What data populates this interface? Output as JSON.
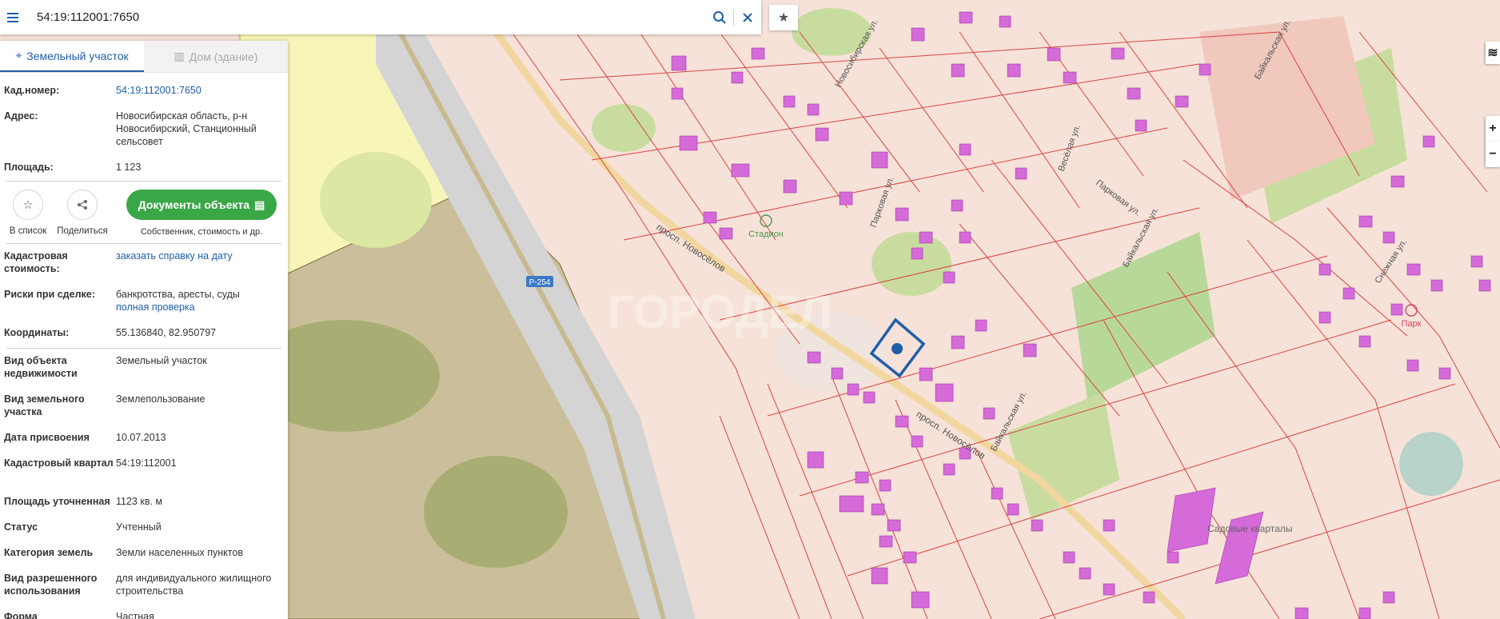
{
  "search": {
    "value": "54:19:112001:7650"
  },
  "tabs": [
    {
      "label": "Земельный участок",
      "active": true
    },
    {
      "label": "Дом (здание)",
      "active": false
    }
  ],
  "summary": [
    {
      "key": "Кад.номер:",
      "value": "54:19:112001:7650",
      "link": true
    },
    {
      "key": "Адрес:",
      "value": "Новосибирская область, р-н Новосибирский, Станционный сельсовет"
    },
    {
      "key": "Площадь:",
      "value": "1 123"
    }
  ],
  "actions": {
    "to_list": "В список",
    "share": "Поделиться",
    "docs_button": "Документы объекта",
    "docs_sub": "Собственник, стоимость и др."
  },
  "cadastral_cost": {
    "key": "Кадастровая стоимость:",
    "value": "заказать справку на дату"
  },
  "risks": {
    "key": "Риски при сделке:",
    "value": "банкротства, аресты, суды",
    "link": "полная проверка"
  },
  "coords": {
    "key": "Координаты:",
    "value": "55.136840, 82.950797"
  },
  "details": [
    {
      "key": "Вид объекта недвижимости",
      "value": "Земельный участок"
    },
    {
      "key": "Вид земельного участка",
      "value": "Землепользование"
    },
    {
      "key": "Дата присвоения",
      "value": "10.07.2013"
    },
    {
      "key": "Кадастровый квартал",
      "value": "54:19:112001"
    },
    {
      "key": "Площадь уточненная",
      "value": "1123 кв. м"
    },
    {
      "key": "Статус",
      "value": "Учтенный"
    },
    {
      "key": "Категория земель",
      "value": "Земли населенных пунктов"
    },
    {
      "key": "Вид разрешенного использования",
      "value": "для индивидуального жилищного строительства"
    },
    {
      "key": "Форма",
      "value": "Частная"
    }
  ],
  "map_labels": {
    "prospekt": "просп. Новосёлов",
    "novosibirskaya": "Новосибирская ул.",
    "parkovaya": "Парковая ул.",
    "parkovaya2": "Парковая ул.",
    "veselaya": "Весёлая ул.",
    "baikalskaya": "Байкальская ул.",
    "baikalskaya2": "Байкальская ул.",
    "baikalskaya3": "Байкальская ул.",
    "snezhnaya": "Снежная ул.",
    "stadium": "Стадион",
    "park": "Парк",
    "sadovye": "Садовые кварталы",
    "road_r254": "Р-254",
    "watermark": "ГОРОДЕЛ"
  },
  "controls": {
    "zoom_in": "+",
    "zoom_out": "−"
  }
}
